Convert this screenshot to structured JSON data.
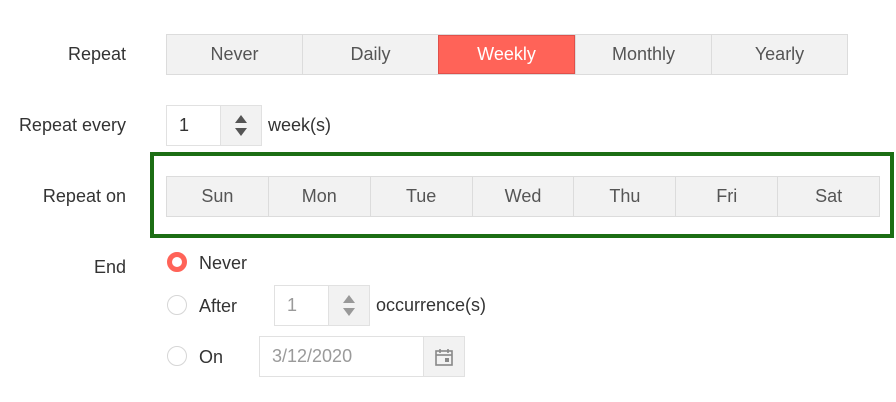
{
  "repeat": {
    "label": "Repeat",
    "options": [
      "Never",
      "Daily",
      "Weekly",
      "Monthly",
      "Yearly"
    ],
    "selected": "Weekly"
  },
  "repeat_every": {
    "label": "Repeat every",
    "value": "1",
    "unit": "week(s)"
  },
  "repeat_on": {
    "label": "Repeat on",
    "days": [
      "Sun",
      "Mon",
      "Tue",
      "Wed",
      "Thu",
      "Fri",
      "Sat"
    ]
  },
  "end": {
    "label": "End",
    "options": {
      "never": "Never",
      "after": "After",
      "on": "On"
    },
    "selected": "never",
    "after_value": "1",
    "after_unit": "occurrence(s)",
    "on_date": "3/12/2020"
  },
  "colors": {
    "accent": "#ff6358",
    "highlight_border": "#1c6e14"
  }
}
